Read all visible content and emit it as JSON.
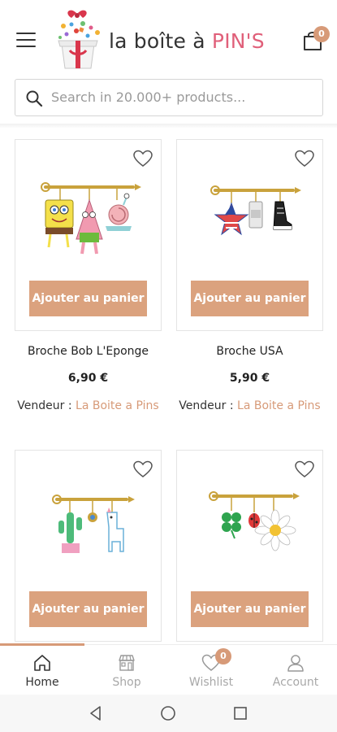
{
  "header": {
    "logo_text_main": "la boîte à ",
    "logo_text_accent": "PIN'S",
    "cart_count": "0"
  },
  "search": {
    "placeholder": "Search in 20.000+ products..."
  },
  "products": [
    {
      "name": "Broche Bob L'Eponge",
      "price": "6,90 €",
      "vendor_label": "Vendeur : ",
      "vendor_name": "La Boite a Pins",
      "button_label": "Ajouter au panier",
      "image_icon": "spongebob-charm-brooch"
    },
    {
      "name": "Broche USA",
      "price": "5,90 €",
      "vendor_label": "Vendeur : ",
      "vendor_name": "La Boite a Pins",
      "button_label": "Ajouter au panier",
      "image_icon": "usa-charm-brooch"
    },
    {
      "button_label": "Ajouter au panier",
      "image_icon": "cactus-llama-charm-brooch"
    },
    {
      "button_label": "Ajouter au panier",
      "image_icon": "clover-daisy-charm-brooch"
    }
  ],
  "bottom_nav": {
    "items": [
      {
        "label": "Home",
        "icon": "home-icon",
        "active": true
      },
      {
        "label": "Shop",
        "icon": "shop-icon"
      },
      {
        "label": "Wishlist",
        "icon": "heart-icon",
        "badge": "0"
      },
      {
        "label": "Account",
        "icon": "user-icon"
      }
    ]
  },
  "colors": {
    "accent": "#d79a78",
    "button": "#dba27e",
    "logo_accent": "#e0607a"
  }
}
